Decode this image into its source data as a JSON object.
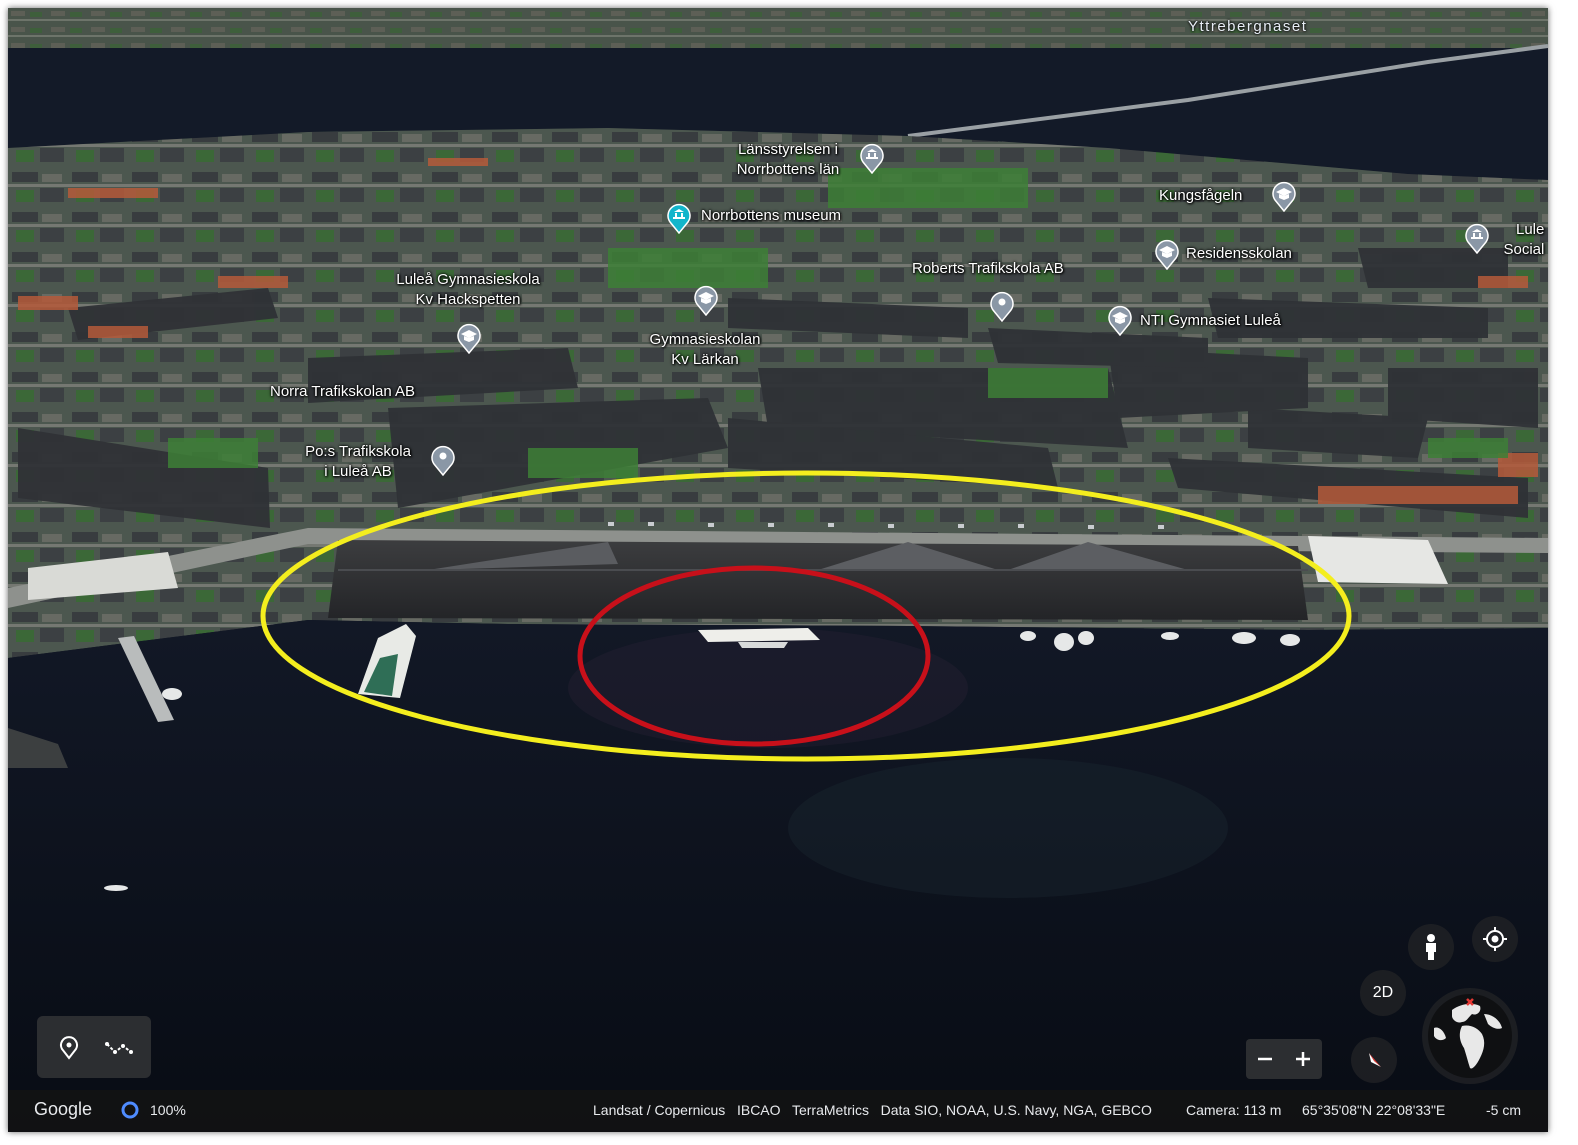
{
  "place_labels": [
    "Yttrebergnaset"
  ],
  "pois": [
    {
      "id": "lansstyrelsen",
      "lines": [
        "Länsstyrelsen i",
        "Norrbottens län"
      ],
      "icon": "museum-pin-icon"
    },
    {
      "id": "museum",
      "lines": [
        "Norrbottens museum"
      ],
      "icon": "museum-pin-icon-teal"
    },
    {
      "id": "kungsfageln",
      "lines": [
        "Kungsfågeln"
      ],
      "icon": "school-pin-icon"
    },
    {
      "id": "lule-social",
      "lines": [
        "Lule",
        "Social"
      ],
      "icon": "museum-pin-icon"
    },
    {
      "id": "residensskolan",
      "lines": [
        "Residensskolan"
      ],
      "icon": "school-pin-icon"
    },
    {
      "id": "roberts",
      "lines": [
        "Roberts Trafikskola AB"
      ],
      "icon": "location-pin-icon"
    },
    {
      "id": "hackspetten",
      "lines": [
        "Luleå Gymnasieskola",
        "Kv Hackspetten"
      ],
      "icon": "school-pin-icon"
    },
    {
      "id": "larkan",
      "lines": [
        "Gymnasieskolan",
        "Kv Lärkan"
      ],
      "icon": "school-pin-icon"
    },
    {
      "id": "nti",
      "lines": [
        "NTI Gymnasiet Luleå"
      ],
      "icon": "school-pin-icon"
    },
    {
      "id": "norra",
      "lines": [
        "Norra Trafikskolan AB"
      ],
      "icon": ""
    },
    {
      "id": "pos",
      "lines": [
        "Po:s Trafikskola",
        "i Luleå AB"
      ],
      "icon": "location-pin-icon"
    }
  ],
  "annotations": [
    {
      "name": "yellow-highlight-ellipse",
      "color": "#f4ee1e"
    },
    {
      "name": "red-highlight-ellipse",
      "color": "#c8101a"
    }
  ],
  "controls": {
    "mode_2d": "2D",
    "zoom_out": "−",
    "zoom_in": "+"
  },
  "footer": {
    "brand": "Google",
    "opacity": "100%",
    "attribution": "Landsat / Copernicus   IBCAO   TerraMetrics   Data SIO, NOAA, U.S. Navy, NGA, GEBCO",
    "camera": "Camera: 113 m",
    "coordinates": "65°35'08\"N 22°08'33\"E",
    "scale": "-5 cm"
  },
  "colors": {
    "water": "#0b111c",
    "pin_gray": "#8a97a6",
    "pin_teal": "#12b5cb",
    "footer_bg": "#121214"
  }
}
